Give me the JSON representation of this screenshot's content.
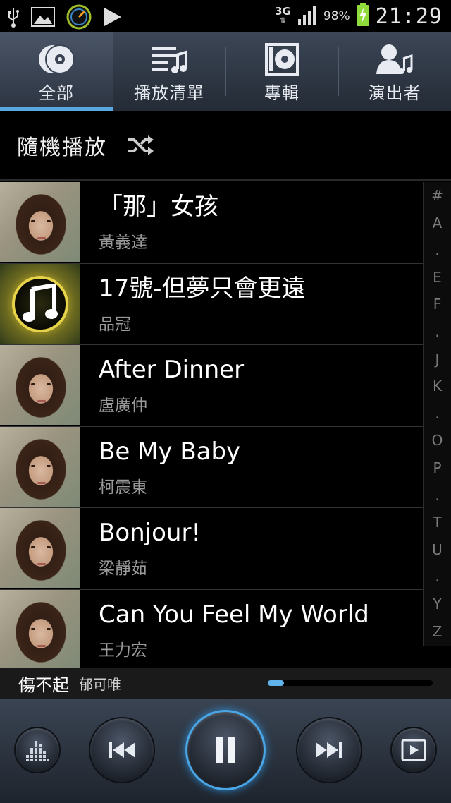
{
  "status_bar": {
    "network": "3G",
    "battery_percent": "98%",
    "time": "21:29",
    "icons": [
      "usb-icon",
      "image-icon",
      "speedometer-icon",
      "play-notification-icon",
      "signal-icon",
      "battery-charging-icon"
    ]
  },
  "tabs": [
    {
      "label": "全部",
      "icon": "disc-icon",
      "active": true
    },
    {
      "label": "播放清單",
      "icon": "playlist-icon",
      "active": false
    },
    {
      "label": "專輯",
      "icon": "album-icon",
      "active": false
    },
    {
      "label": "演出者",
      "icon": "artist-icon",
      "active": false
    }
  ],
  "shuffle": {
    "label": "隨機播放",
    "icon": "shuffle-icon"
  },
  "songs": [
    {
      "title": "「那」女孩",
      "artist": "黃義達",
      "art": "photo"
    },
    {
      "title": "17號-但夢只會更遠",
      "artist": "品冠",
      "art": "note"
    },
    {
      "title": "After Dinner",
      "artist": "盧廣仲",
      "art": "photo"
    },
    {
      "title": "Be My Baby",
      "artist": "柯震東",
      "art": "photo"
    },
    {
      "title": "Bonjour!",
      "artist": "梁靜茹",
      "art": "photo"
    },
    {
      "title": "Can You Feel My World",
      "artist": "王力宏",
      "art": "photo"
    }
  ],
  "index_letters": [
    "#",
    "A",
    ".",
    "E",
    "F",
    ".",
    "J",
    "K",
    ".",
    "O",
    "P",
    ".",
    "T",
    "U",
    ".",
    "Y",
    "Z"
  ],
  "now_playing": {
    "title": "傷不起",
    "artist": "郁可唯",
    "progress": 0.1
  },
  "controls": {
    "colors": {
      "accent": "#5fb4ec",
      "tab_bg": "#2c3441"
    }
  }
}
